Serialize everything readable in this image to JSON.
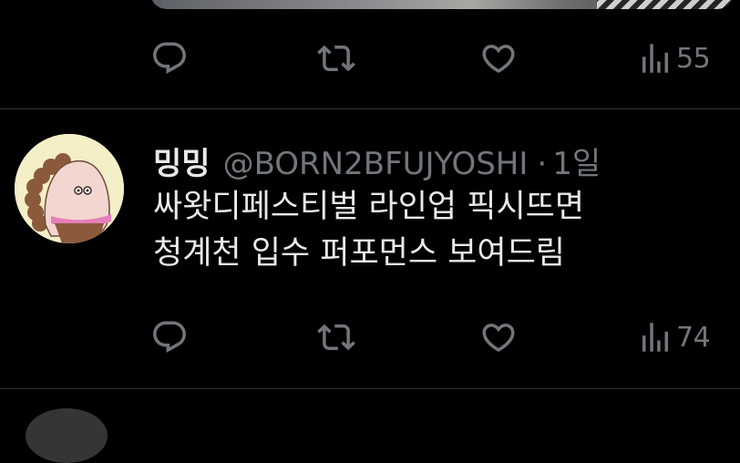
{
  "previous_tweet": {
    "actions": {
      "reply_icon": "reply-icon",
      "retweet_icon": "retweet-icon",
      "like_icon": "heart-icon",
      "views_icon": "views-icon",
      "views_count": "55"
    }
  },
  "tweet": {
    "display_name": "밍밍",
    "handle": "@BORN2BFUJYOSHI",
    "separator": "·",
    "time": "1일",
    "text_lines": [
      "싸왓디페스티벌 라인업 픽시뜨면",
      "청계천 입수 퍼포먼스 보여드림"
    ],
    "actions": {
      "reply_icon": "reply-icon",
      "retweet_icon": "retweet-icon",
      "like_icon": "heart-icon",
      "views_icon": "views-icon",
      "views_count": "74"
    }
  },
  "colors": {
    "background": "#000000",
    "primary_text": "#e7e9ea",
    "secondary_text": "#71767b",
    "divider": "#2f3336"
  }
}
